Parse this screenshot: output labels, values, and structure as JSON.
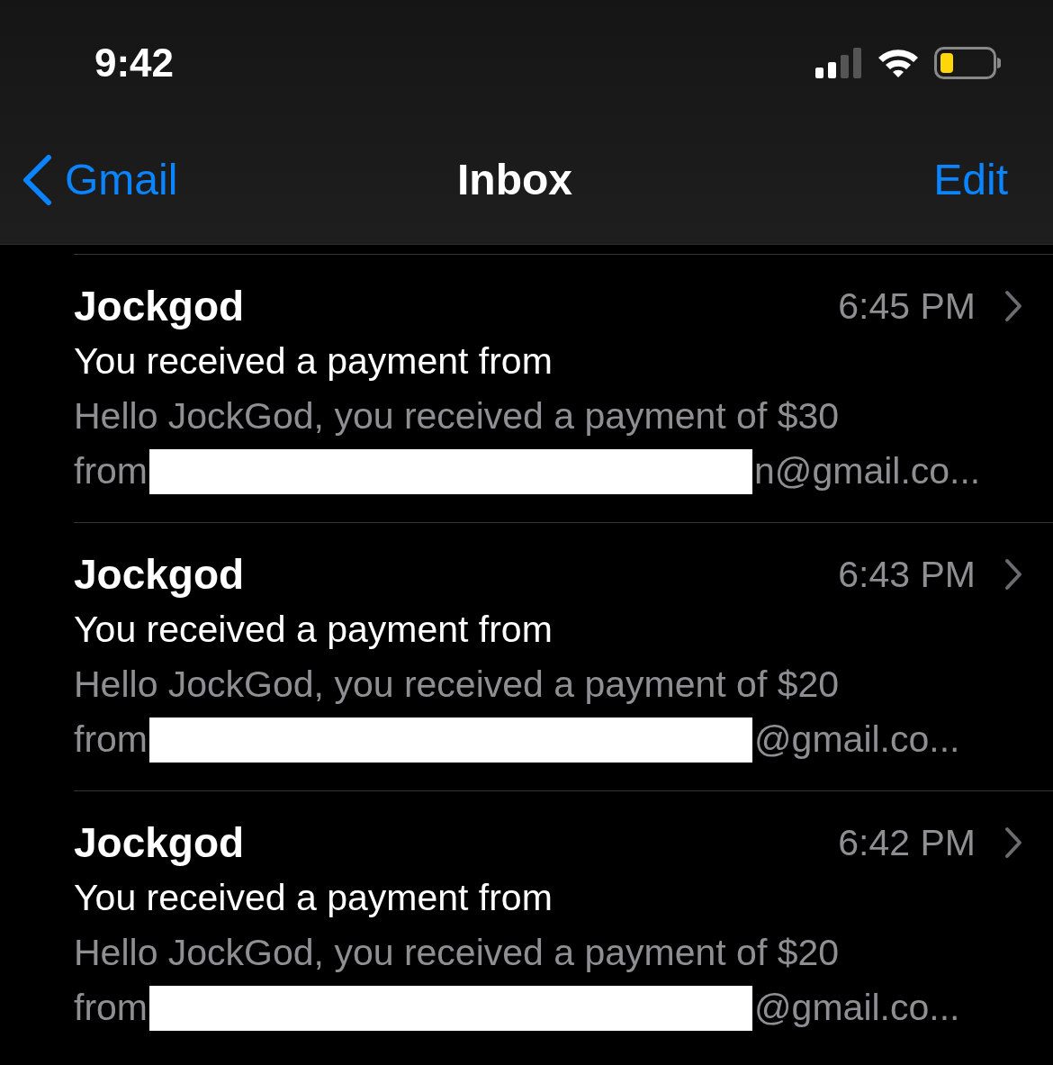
{
  "status_bar": {
    "time": "9:42"
  },
  "nav": {
    "back": "Gmail",
    "title": "Inbox",
    "action": "Edit"
  },
  "messages": [
    {
      "sender": "Jockgod",
      "time": "6:45 PM",
      "subject": "You received a payment from",
      "preview": "Hello JockGod, you received a payment of $30",
      "preview_start": "from",
      "redacted": true,
      "preview_end": "n@gmail.co..."
    },
    {
      "sender": "Jockgod",
      "time": "6:43 PM",
      "subject": "You received a payment from",
      "preview": "Hello JockGod, you received a payment of $20",
      "preview_start": "from",
      "redacted": true,
      "preview_end": "@gmail.co..."
    },
    {
      "sender": "Jockgod",
      "time": "6:42 PM",
      "subject": "You received a payment from",
      "preview": "Hello JockGod, you received a payment of $20",
      "preview_start": "from",
      "redacted": true,
      "preview_end": "@gmail.co..."
    }
  ]
}
